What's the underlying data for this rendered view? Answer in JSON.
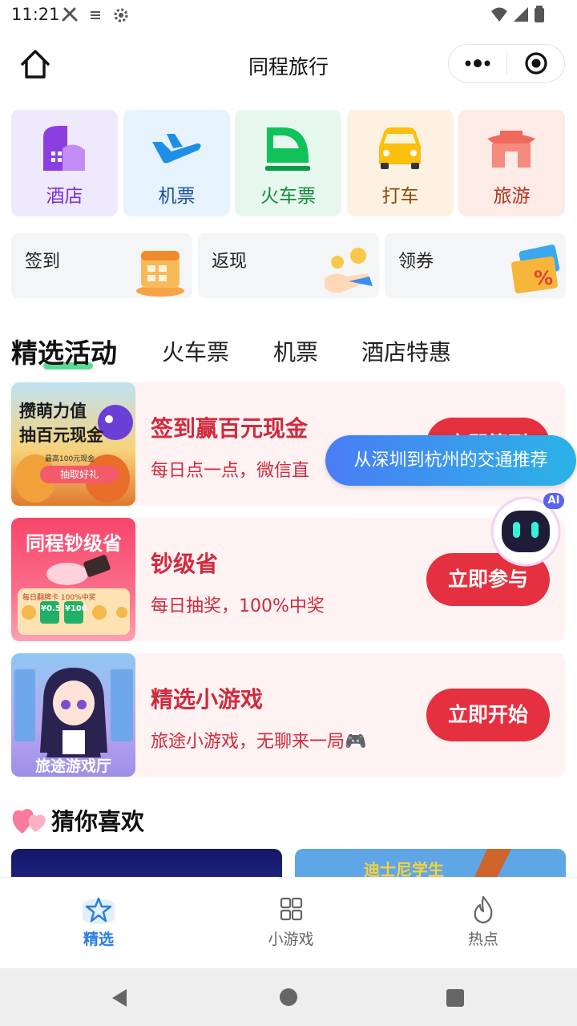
{
  "status_bar": {
    "time": "11:21"
  },
  "header": {
    "title": "同程旅行"
  },
  "services": [
    {
      "label": "酒店",
      "icon": "hotel-icon",
      "bg": "#efe9fd",
      "color": "#7a2fd6"
    },
    {
      "label": "机票",
      "icon": "plane-icon",
      "bg": "#e6f3fd",
      "color": "#1c4f9c"
    },
    {
      "label": "火车票",
      "icon": "train-icon",
      "bg": "#e6f7ee",
      "color": "#138a3b"
    },
    {
      "label": "打车",
      "icon": "taxi-icon",
      "bg": "#fdf1e2",
      "color": "#8a4a08"
    },
    {
      "label": "旅游",
      "icon": "pagoda-icon",
      "bg": "#fdebe7",
      "color": "#b03420"
    }
  ],
  "mini_entries": [
    {
      "label": "签到",
      "icon": "calendar-icon"
    },
    {
      "label": "返现",
      "icon": "coins-hand-icon"
    },
    {
      "label": "领券",
      "icon": "coupon-icon"
    }
  ],
  "tabs": [
    {
      "label": "精选活动",
      "active": true
    },
    {
      "label": "火车票"
    },
    {
      "label": "机票"
    },
    {
      "label": "酒店特惠"
    }
  ],
  "activities": [
    {
      "title": "签到赢百元现金",
      "desc": "每日点一点，微信直",
      "cta": "立即签到",
      "thumb_text_1": "攒萌力值",
      "thumb_text_2": "抽百元现金",
      "thumb_btn": "抽取好礼",
      "thumb_small": "最高100元现金"
    },
    {
      "title": "钞级省",
      "desc": "每日抽奖，100%中奖",
      "cta": "立即参与",
      "thumb_text_1": "同程钞级省",
      "thumb_small": "每日翻牌卡 100%中奖",
      "thumb_v1": "¥0.5",
      "thumb_v2": "¥100"
    },
    {
      "title": "精选小游戏",
      "desc": "旅途小游戏，无聊来一局🎮",
      "cta": "立即开始",
      "thumb_text_1": "旅途游戏厅"
    }
  ],
  "ai_assistant": {
    "suggestion": "从深圳到杭州的交通推荐",
    "badge": "AI"
  },
  "recommend": {
    "title": "猜你喜欢",
    "card2_text": "迪士尼学生"
  },
  "bottom_nav": [
    {
      "label": "精选",
      "icon": "star-icon",
      "active": true
    },
    {
      "label": "小游戏",
      "icon": "grid-icon"
    },
    {
      "label": "热点",
      "icon": "flame-icon"
    }
  ]
}
